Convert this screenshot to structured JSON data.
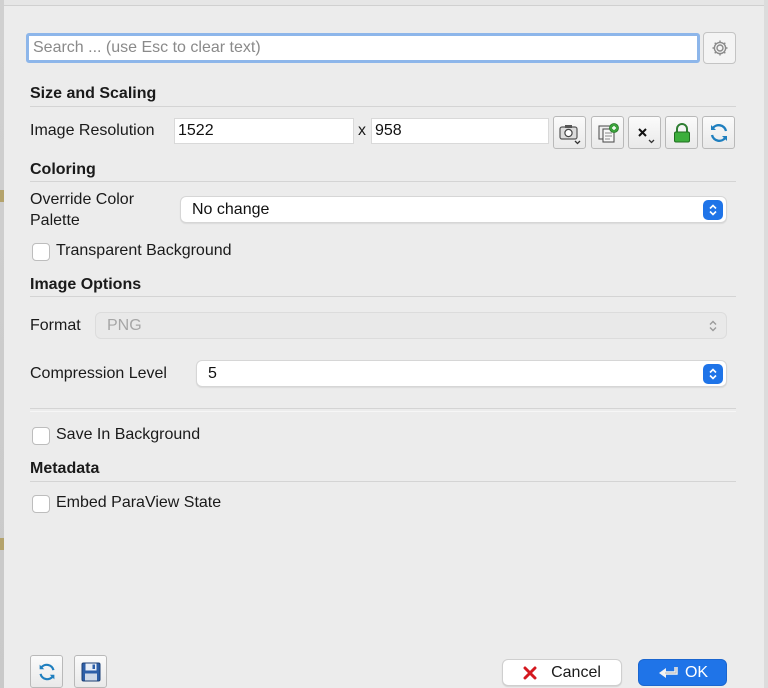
{
  "search": {
    "placeholder": "Search ... (use Esc to clear text)",
    "value": ""
  },
  "sections": {
    "size_scaling": "Size and Scaling",
    "coloring": "Coloring",
    "image_options": "Image Options",
    "metadata": "Metadata"
  },
  "resolution": {
    "label": "Image Resolution",
    "width": "1522",
    "separator": "x",
    "height": "958"
  },
  "palette": {
    "label_line1": "Override Color",
    "label_line2": "Palette",
    "value": "No change"
  },
  "transparent_bg": {
    "label": "Transparent Background",
    "checked": false
  },
  "format": {
    "label": "Format",
    "value": "PNG",
    "enabled": false
  },
  "compression": {
    "label": "Compression Level",
    "value": "5"
  },
  "save_bg": {
    "label": "Save In Background",
    "checked": false
  },
  "embed_state": {
    "label": "Embed ParaView State",
    "checked": false
  },
  "buttons": {
    "cancel": "Cancel",
    "ok": "OK"
  },
  "colors": {
    "accent": "#1f74e8",
    "focus_ring": "#8db6ea",
    "lock_green": "#2ea043",
    "cancel_red": "#d4181f"
  },
  "icons": {
    "gear": "gear-icon",
    "camera": "camera-icon",
    "copy": "copy-resolution-icon",
    "preset": "resolution-preset-icon",
    "lock": "lock-icon",
    "reset": "reset-icon",
    "refresh": "refresh-icon",
    "save": "save-icon",
    "cancel": "cancel-x-icon",
    "ok": "ok-arrow-icon"
  }
}
